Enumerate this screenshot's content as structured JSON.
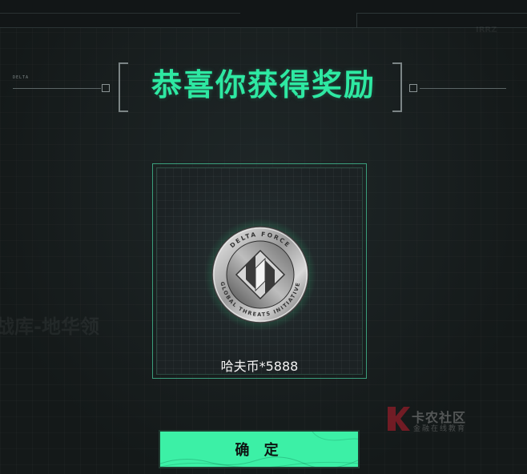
{
  "dialog": {
    "title": "恭喜你获得奖励",
    "reward_label": "哈夫币*5888",
    "confirm_label": "确 定"
  },
  "coin": {
    "ring_text_top": "DELTA FORCE",
    "ring_text_bottom": "GLOBAL THREATS INITIATIVE"
  },
  "background": {
    "faded_text_left": "战库-地华领",
    "top_left_micro": "DELTA",
    "top_right_micro": "IRRZ"
  },
  "watermark": {
    "title": "卡农社区",
    "subtitle": "金融在线教育"
  },
  "colors": {
    "accent": "#2ee8a2",
    "button": "#3cf0a6",
    "background": "#171d1e"
  }
}
